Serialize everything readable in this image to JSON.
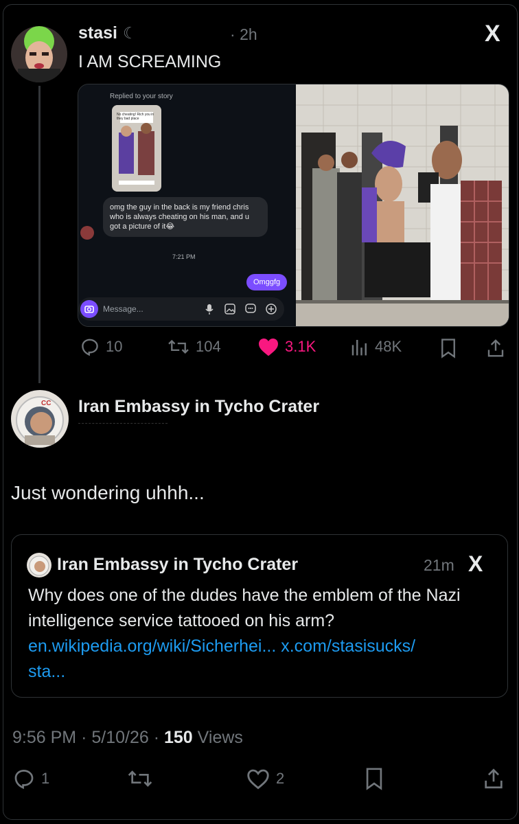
{
  "tweet": {
    "author_name": "stasi",
    "author_glyph": "☾",
    "time": "2h",
    "separator": "·",
    "text": "I AM SCREAMING",
    "x_mark": "X",
    "media": {
      "dm": {
        "replied_label": "Replied to your story",
        "story_caption": "No cheating! Rich you in they bad place",
        "incoming_message": "omg the guy in the back is my friend chris who is always cheating on his man, and u got a picture of it😂",
        "timestamp": "7:21 PM",
        "outgoing_message": "Omggfg",
        "composer_placeholder": "Message..."
      }
    },
    "actions": {
      "replies": "10",
      "reposts": "104",
      "likes": "3.1K",
      "views": "48K"
    }
  },
  "reply": {
    "author_name": "Iran Embassy in Tycho Crater",
    "text": "Just wondering uhhh...",
    "quote": {
      "author_name": "Iran Embassy in Tycho Crater",
      "time": "21m",
      "x_mark": "X",
      "text": "Why does one of the dudes have the emblem of the Nazi intelligence service tattooed on his arm?",
      "link1": "en.wikipedia.org/wiki/Sicherhei...",
      "link2": "x.com/stasisucks/",
      "link3": "sta..."
    },
    "footer": {
      "time": "9:56 PM",
      "sep1": "·",
      "date": "5/10/26",
      "sep2": "·",
      "views_count": "150",
      "views_label": "Views"
    },
    "actions": {
      "replies": "1",
      "likes": "2"
    }
  },
  "icons": {
    "reply": "reply-icon",
    "repost": "repost-icon",
    "like": "heart-icon",
    "views": "views-icon",
    "bookmark": "bookmark-icon",
    "share": "share-icon"
  },
  "colors": {
    "background": "#000000",
    "text": "#e7e9ea",
    "muted": "#71767b",
    "like": "#f91880",
    "link": "#1d9bf0",
    "dm_purple": "#7b4dff"
  }
}
